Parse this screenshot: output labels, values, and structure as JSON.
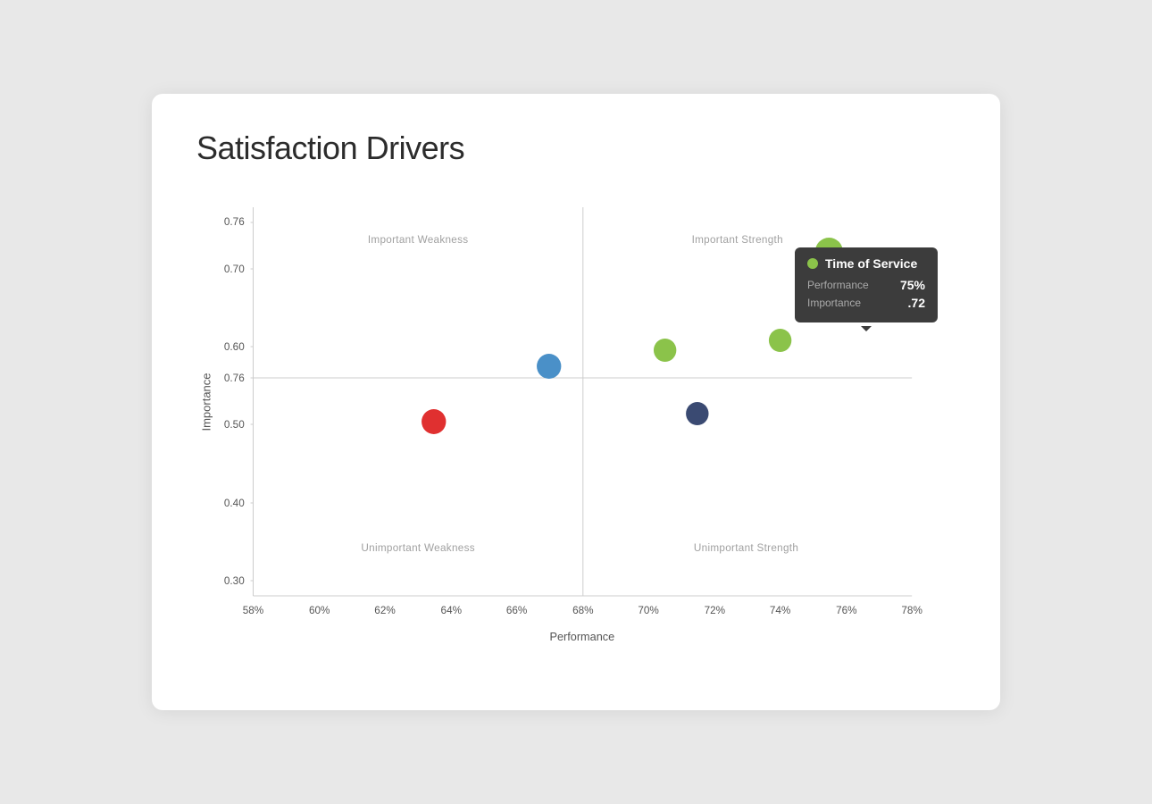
{
  "card": {
    "title": "Satisfaction Drivers"
  },
  "axes": {
    "x_label": "Performance",
    "y_label": "Importance",
    "x_ticks": [
      "58%",
      "60%",
      "62%",
      "64%",
      "66%",
      "68%",
      "70%",
      "72%",
      "74%",
      "76%",
      "78%"
    ],
    "y_ticks": [
      "0.30",
      "0.40",
      "0.50",
      "0.60",
      "0.70",
      "0.76"
    ],
    "x_min": 58,
    "x_max": 78,
    "y_min": 0.28,
    "y_max": 0.78,
    "divider_x": 68,
    "divider_y": 0.56
  },
  "quadrant_labels": {
    "important_weakness": "Important Weakness",
    "important_strength": "Important Strength",
    "unimportant_weakness": "Unimportant Weakness",
    "unimportant_strength": "Unimportant Strength"
  },
  "data_points": [
    {
      "id": "blue1",
      "x": 67,
      "y": 0.575,
      "color": "#4a90c8",
      "size": 14
    },
    {
      "id": "red1",
      "x": 63.5,
      "y": 0.504,
      "color": "#e03030",
      "size": 14
    },
    {
      "id": "green1",
      "x": 70.5,
      "y": 0.596,
      "color": "#8bc34a",
      "size": 13
    },
    {
      "id": "green2",
      "x": 74,
      "y": 0.608,
      "color": "#8bc34a",
      "size": 13
    },
    {
      "id": "green3",
      "x": 75.5,
      "y": 0.722,
      "color": "#8bc34a",
      "size": 16
    },
    {
      "id": "navy1",
      "x": 71.5,
      "y": 0.514,
      "color": "#3a4a72",
      "size": 13
    }
  ],
  "tooltip": {
    "label": "Time of Service",
    "dot_color": "#8bc34a",
    "performance_label": "Performance",
    "performance_value": "75%",
    "importance_label": "Importance",
    "importance_value": ".72"
  }
}
